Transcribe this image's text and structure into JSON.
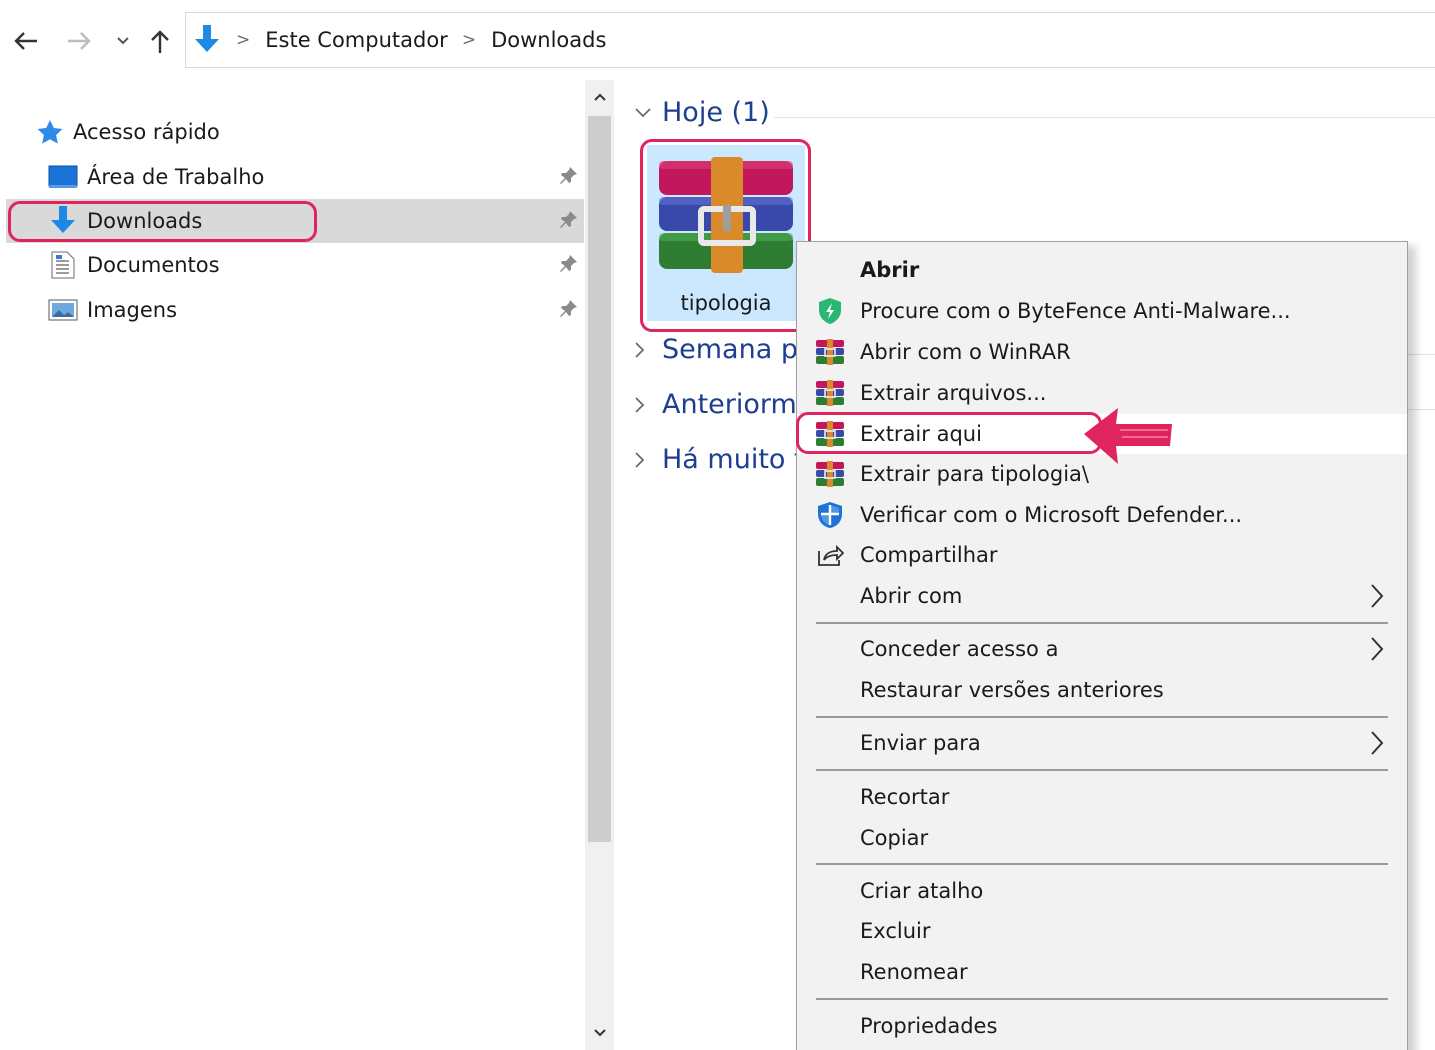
{
  "breadcrumb": {
    "items": [
      "Este Computador",
      "Downloads"
    ]
  },
  "sidebar": {
    "items": [
      {
        "label": "Acesso rápido",
        "icon": "star-icon",
        "pinned": false
      },
      {
        "label": "Área de Trabalho",
        "icon": "desktop-icon",
        "pinned": true
      },
      {
        "label": "Downloads",
        "icon": "download-icon",
        "pinned": true,
        "selected": true
      },
      {
        "label": "Documentos",
        "icon": "document-icon",
        "pinned": true
      },
      {
        "label": "Imagens",
        "icon": "pictures-icon",
        "pinned": true
      }
    ]
  },
  "content": {
    "groups": [
      {
        "label": "Hoje (1)",
        "expanded": true
      },
      {
        "label": "Semana pa",
        "expanded": false
      },
      {
        "label": "Anteriorme",
        "expanded": false
      },
      {
        "label": "Há muito t",
        "expanded": false
      }
    ],
    "file": {
      "name": "tipologia",
      "icon": "winrar-archive-icon",
      "selected": true
    }
  },
  "context_menu": {
    "items": [
      {
        "label": "Abrir",
        "bold": true
      },
      {
        "label": "Procure com o ByteFence Anti-Malware...",
        "icon": "bytefence-shield-icon"
      },
      {
        "label": "Abrir com o WinRAR",
        "icon": "winrar-icon"
      },
      {
        "label": "Extrair arquivos...",
        "icon": "winrar-icon"
      },
      {
        "label": "Extrair aqui",
        "icon": "winrar-icon",
        "hover": true
      },
      {
        "label": "Extrair para tipologia\\",
        "icon": "winrar-icon"
      },
      {
        "label": "Verificar com o Microsoft Defender...",
        "icon": "defender-shield-icon"
      },
      {
        "label": "Compartilhar",
        "icon": "share-icon"
      },
      {
        "label": "Abrir com",
        "submenu": true
      },
      {
        "label": "Conceder acesso a",
        "submenu": true
      },
      {
        "label": "Restaurar versões anteriores"
      },
      {
        "label": "Enviar para",
        "submenu": true
      },
      {
        "label": "Recortar"
      },
      {
        "label": "Copiar"
      },
      {
        "label": "Criar atalho"
      },
      {
        "label": "Excluir"
      },
      {
        "label": "Renomear"
      },
      {
        "label": "Propriedades"
      }
    ]
  },
  "colors": {
    "selection_fill": "#cce8ff",
    "annotation_pink": "#e0245e",
    "group_header_blue": "#1e3f8f"
  }
}
